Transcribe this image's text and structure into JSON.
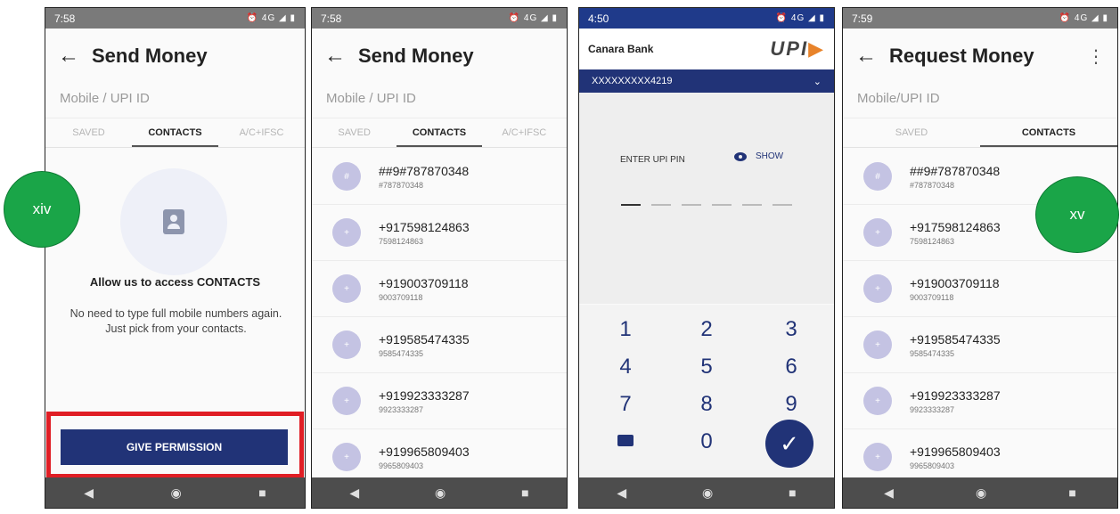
{
  "phone1": {
    "time": "7:58",
    "status_icons": "⏰ 4G ◢ ▮",
    "title": "Send Money",
    "search_placeholder": "Mobile / UPI ID",
    "tabs": [
      "SAVED",
      "CONTACTS",
      "A/C+IFSC"
    ],
    "allow_title": "Allow us to access CONTACTS",
    "allow_desc": "No need to type full mobile numbers again. Just pick from your contacts.",
    "button": "GIVE PERMISSION"
  },
  "phone2": {
    "time": "7:58",
    "status_icons": "⏰ 4G ◢ ▮",
    "title": "Send Money",
    "search_placeholder": "Mobile / UPI ID",
    "tabs": [
      "SAVED",
      "CONTACTS",
      "A/C+IFSC"
    ]
  },
  "phone3": {
    "time": "4:50",
    "status_icons": "⏰ 4G ◢ ▮",
    "bank": "Canara Bank",
    "upi_logo": "UPI",
    "account": "XXXXXXXXX4219",
    "pin_label": "ENTER UPI PIN",
    "show": "SHOW",
    "keys": [
      "1",
      "2",
      "3",
      "4",
      "5",
      "6",
      "7",
      "8",
      "9",
      "0"
    ]
  },
  "phone4": {
    "time": "7:59",
    "status_icons": "⏰ 4G ◢ ▮",
    "title": "Request Money",
    "search_placeholder": "Mobile/UPI ID",
    "tabs": [
      "SAVED",
      "CONTACTS"
    ]
  },
  "contacts": [
    {
      "avatar": "#",
      "name": "##9#787870348",
      "number": "#787870348"
    },
    {
      "avatar": "+",
      "name": "+917598124863",
      "number": "7598124863"
    },
    {
      "avatar": "+",
      "name": "+919003709118",
      "number": "9003709118"
    },
    {
      "avatar": "+",
      "name": "+919585474335",
      "number": "9585474335"
    },
    {
      "avatar": "+",
      "name": "+919923333287",
      "number": "9923333287"
    },
    {
      "avatar": "+",
      "name": "+919965809403",
      "number": "9965809403"
    }
  ],
  "badges": {
    "left": "xiv",
    "right": "xv"
  },
  "colors": {
    "primary": "#213377",
    "highlight": "#e01e25",
    "badge": "#1aa548"
  }
}
